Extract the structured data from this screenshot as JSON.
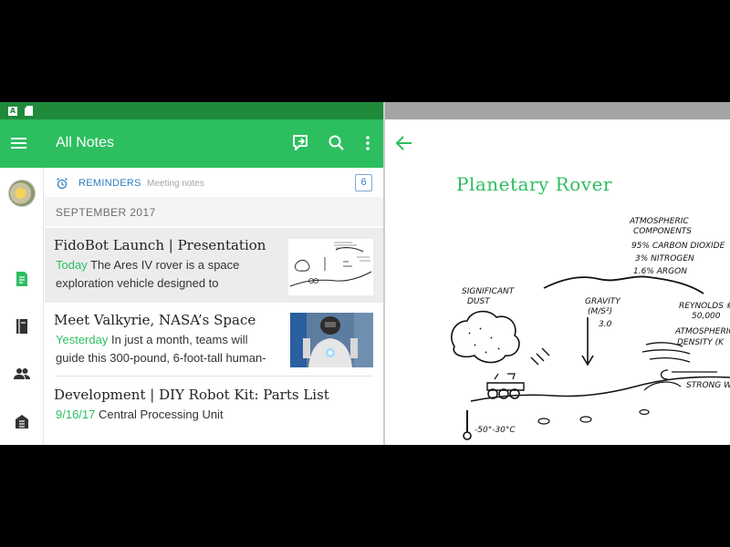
{
  "app_bar": {
    "title": "All Notes"
  },
  "reminders": {
    "label": "REMINDERS",
    "subtitle": "Meeting notes",
    "count": "6"
  },
  "section": {
    "header": "SEPTEMBER 2017"
  },
  "notes": [
    {
      "title": "FidoBot Launch | Presentation",
      "when": "Today",
      "snippet": "The Ares IV rover is a space exploration vehicle designed to"
    },
    {
      "title": "Meet Valkyrie, NASA’s Space",
      "when": "Yesterday",
      "snippet": "In just a month, teams will guide this 300-pound, 6-foot-tall human-"
    },
    {
      "title": "Development | DIY Robot Kit: Parts List",
      "when": "9/16/17",
      "snippet": "Central Processing Unit"
    }
  ],
  "note_view": {
    "title": "Planetary Rover",
    "sketch_labels": {
      "atmo1": "ATMOSPHERIC",
      "atmo2": "COMPONENTS",
      "atmo3": "95% CARBON DIOXIDE",
      "atmo4": "3% NITROGEN",
      "atmo5": "1.6% ARGON",
      "dust1": "SIGNIFICANT",
      "dust2": "DUST",
      "grav1": "GRAVITY",
      "grav2": "(M/S²)",
      "grav3": "3.0",
      "rey1": "REYNOLDS #",
      "rey2": "50,000",
      "dens1": "ATMOSPHERIC",
      "dens2": "DENSITY (K",
      "wind": "STRONG W",
      "temp": "-50°-30°C"
    }
  },
  "colors": {
    "brand_green": "#2dbe60",
    "status_green": "#1f8a3a",
    "link_blue": "#2d7fc2"
  }
}
